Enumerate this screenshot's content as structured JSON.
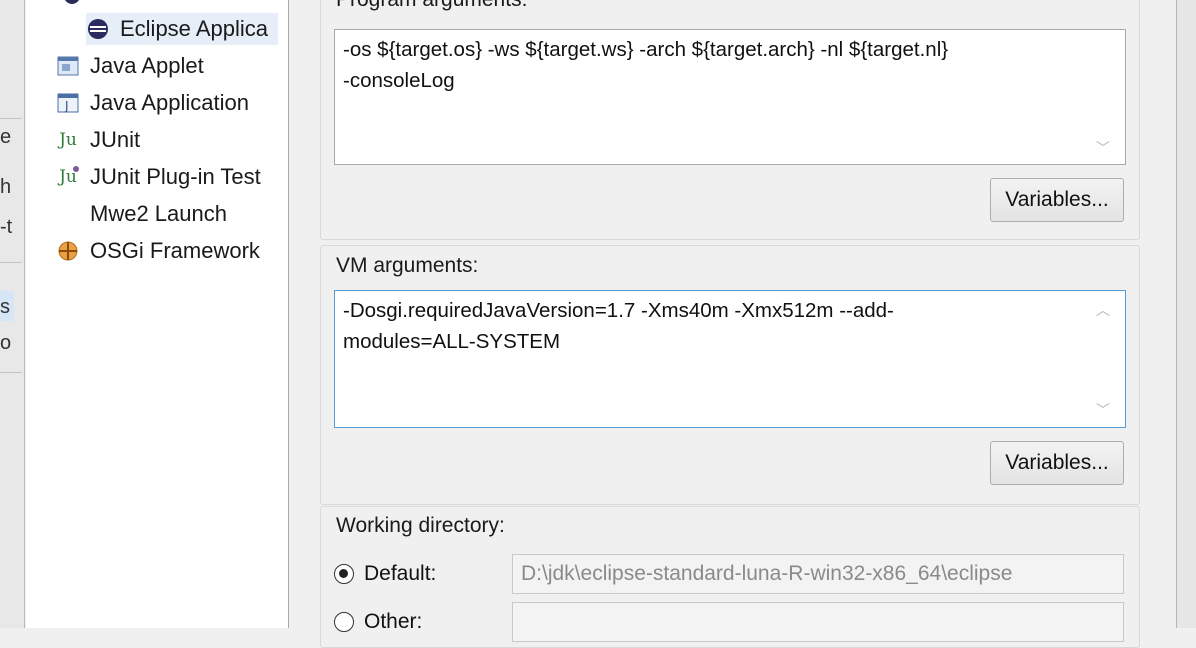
{
  "tree": {
    "items": [
      {
        "label": "Eclipse Applica",
        "icon": "eclipse-icon"
      },
      {
        "label": "Java Applet",
        "icon": "java-applet-icon"
      },
      {
        "label": "Java Application",
        "icon": "java-application-icon"
      },
      {
        "label": "JUnit",
        "icon": "junit-icon"
      },
      {
        "label": "JUnit Plug-in Test",
        "icon": "junit-plugin-icon"
      },
      {
        "label": "Mwe2 Launch",
        "icon": ""
      },
      {
        "label": "OSGi Framework",
        "icon": "osgi-icon"
      }
    ],
    "junit_icon_text": "Ju"
  },
  "program_arguments": {
    "title": "Program arguments:",
    "value": "-os ${target.os} -ws ${target.ws} -arch ${target.arch} -nl ${target.nl}\n-consoleLog",
    "variables_label": "Variables..."
  },
  "vm_arguments": {
    "title": "VM arguments:",
    "value": "-Dosgi.requiredJavaVersion=1.7 -Xms40m -Xmx512m --add-\nmodules=ALL-SYSTEM",
    "variables_label": "Variables..."
  },
  "working_directory": {
    "title": "Working directory:",
    "default_label": "Default:",
    "default_value": "D:\\jdk\\eclipse-standard-luna-R-win32-x86_64\\eclipse",
    "other_label": "Other:",
    "other_value": "",
    "selected": "default"
  },
  "colors": {
    "focus_border": "#5a9bd5",
    "selection_bg": "#e6eef8"
  }
}
